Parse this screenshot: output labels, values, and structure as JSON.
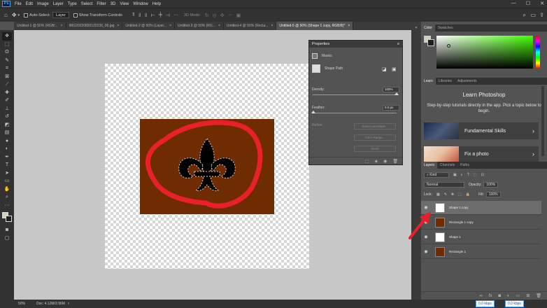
{
  "app": {
    "logo": "Ps"
  },
  "menu": [
    "File",
    "Edit",
    "Image",
    "Layer",
    "Type",
    "Select",
    "Filter",
    "3D",
    "View",
    "Window",
    "Help"
  ],
  "window_controls": {
    "minimize": "—",
    "maximize": "☐",
    "close": "✕"
  },
  "options": {
    "auto_select_label": "Auto-Select:",
    "auto_select_value": "Layer",
    "transform_label": "Show Transform Controls",
    "mode3d_label": "3D Mode:"
  },
  "tabs": [
    {
      "label": "Untitled-1 @ 50% (RGB/...",
      "close": "×"
    },
    {
      "label": "IMG20220820120236_00.jpg",
      "close": "×"
    },
    {
      "label": "Untitled-2 @ 50% (Layer...",
      "close": "×"
    },
    {
      "label": "Untitled-3 @ 50% (RG...",
      "close": "×"
    },
    {
      "label": "Untitled-4 @ 50% (Recta...",
      "close": "×"
    },
    {
      "label": "Untitled-5 @ 50% (Shape 1 copy, RGB/8)*",
      "close": "×"
    }
  ],
  "properties": {
    "title": "Properties",
    "masks_label": "Masks",
    "mask_type": "Shape Path",
    "density_label": "Density:",
    "density_value": "100%",
    "feather_label": "Feather:",
    "feather_value": "0.0 px",
    "refine_label": "Refine:",
    "btn_select_mask": "Select and Mask...",
    "btn_color_range": "Color Range...",
    "btn_invert": "Invert"
  },
  "color_panel": {
    "tabs": [
      "Color",
      "Swatches"
    ]
  },
  "learn_panel": {
    "tabs": [
      "Learn",
      "Libraries",
      "Adjustments"
    ],
    "title": "Learn Photoshop",
    "description": "Step-by-step tutorials directly in the app. Pick a topic below to begin.",
    "cards": [
      {
        "label": "Fundamental Skills"
      },
      {
        "label": "Fix a photo"
      }
    ]
  },
  "layers_panel": {
    "tabs": [
      "Layers",
      "Channels",
      "Paths"
    ],
    "kind_label": "Kind",
    "blend_mode": "Normal",
    "opacity_label": "Opacity:",
    "opacity_value": "100%",
    "lock_label": "Lock:",
    "fill_label": "Fill:",
    "fill_value": "100%",
    "layers": [
      {
        "name": "Shape 1 copy",
        "selected": true,
        "thumb": "#ffffff"
      },
      {
        "name": "Rectangle 1 copy",
        "selected": false,
        "thumb": "#6e2c00"
      },
      {
        "name": "Shape 1",
        "selected": false,
        "thumb": "#ffffff"
      },
      {
        "name": "Rectangle 1",
        "selected": false,
        "thumb": "#6e2c00"
      }
    ]
  },
  "status": {
    "zoom": "50%",
    "doc": "Doc: 4.12M/3.96M",
    "net_up": "0.0 kbps",
    "net_down": "0.0 kbps"
  },
  "colors": {
    "rectangle": "#6e2c00",
    "ellipse_stroke": "#e8202a",
    "arrow": "#e8202a",
    "foreground": "#c9d3c0"
  }
}
